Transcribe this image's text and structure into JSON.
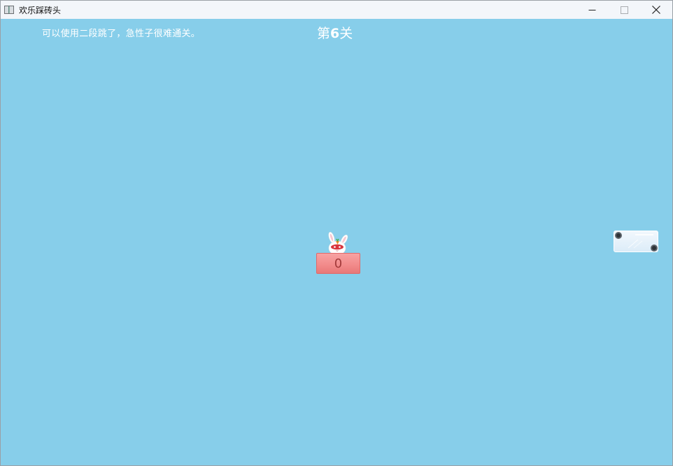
{
  "window": {
    "title": "欢乐踩砖头",
    "icon": "app-window-icon",
    "controls": [
      "minimize-icon",
      "maximize-icon",
      "close-icon"
    ]
  },
  "game": {
    "background_color": "#87ceea",
    "hint": "可以使用二段跳了，急性子很难通关。",
    "level": {
      "prefix": "第",
      "number": "6",
      "suffix": "关"
    },
    "bricks": [
      {
        "type": "red",
        "color": "#f28a8a",
        "count": "0"
      },
      {
        "type": "ice",
        "color": "#e6f1fa"
      }
    ],
    "player": {
      "icon": "rabbit-icon"
    }
  }
}
